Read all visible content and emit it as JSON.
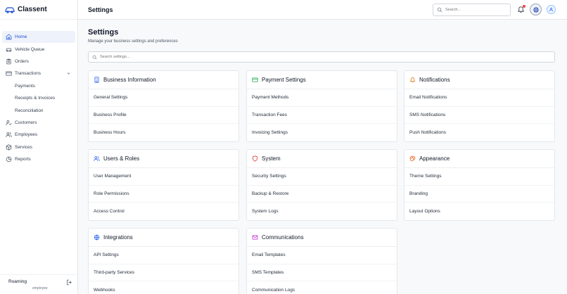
{
  "app": {
    "name": "Classent"
  },
  "sidebar": {
    "items": [
      {
        "label": "Home",
        "icon": "home-icon",
        "active": true
      },
      {
        "label": "Vehicle Queue",
        "icon": "car-icon"
      },
      {
        "label": "Orders",
        "icon": "clipboard-icon"
      },
      {
        "label": "Transactions",
        "icon": "credit-card-icon",
        "expanded": true
      },
      {
        "label": "Payments",
        "sub": true
      },
      {
        "label": "Receipts & Invoices",
        "sub": true
      },
      {
        "label": "Reconciliation",
        "sub": true
      },
      {
        "label": "Customers",
        "icon": "user-check-icon"
      },
      {
        "label": "Employees",
        "icon": "users-icon"
      },
      {
        "label": "Services",
        "icon": "box-icon"
      },
      {
        "label": "Reports",
        "icon": "pie-chart-icon"
      }
    ],
    "user": {
      "name": "Roaming",
      "role": "employee"
    }
  },
  "header": {
    "title": "Settings",
    "search_placeholder": "Search..."
  },
  "main": {
    "title": "Settings",
    "subtitle": "Manage your business settings and preferences",
    "search_placeholder": "Search settings..."
  },
  "cards": [
    {
      "title": "Business Information",
      "icon": "building-icon",
      "color": "#2563eb",
      "items": [
        "General Settings",
        "Business Profile",
        "Business Hours"
      ]
    },
    {
      "title": "Payment Settings",
      "icon": "credit-card-icon",
      "color": "#16a34a",
      "items": [
        "Payment Methods",
        "Transaction Fees",
        "Invoicing Settings"
      ]
    },
    {
      "title": "Notifications",
      "icon": "bell-icon",
      "color": "#d97706",
      "items": [
        "Email Notifications",
        "SMS Notifications",
        "Push Notifications"
      ]
    },
    {
      "title": "Users & Roles",
      "icon": "users-icon",
      "color": "#2563eb",
      "items": [
        "User Management",
        "Role Permissions",
        "Access Control"
      ]
    },
    {
      "title": "System",
      "icon": "shield-icon",
      "color": "#dc2626",
      "items": [
        "Security Settings",
        "Backup & Restore",
        "System Logs"
      ]
    },
    {
      "title": "Appearance",
      "icon": "palette-icon",
      "color": "#ea580c",
      "items": [
        "Theme Settings",
        "Branding",
        "Layout Options"
      ]
    },
    {
      "title": "Integrations",
      "icon": "globe-icon",
      "color": "#2563eb",
      "items": [
        "API Settings",
        "Third-party Services",
        "Webhooks"
      ]
    },
    {
      "title": "Communications",
      "icon": "mail-icon",
      "color": "#c026d3",
      "items": [
        "Email Templates",
        "SMS Templates",
        "Communication Logs"
      ]
    }
  ]
}
